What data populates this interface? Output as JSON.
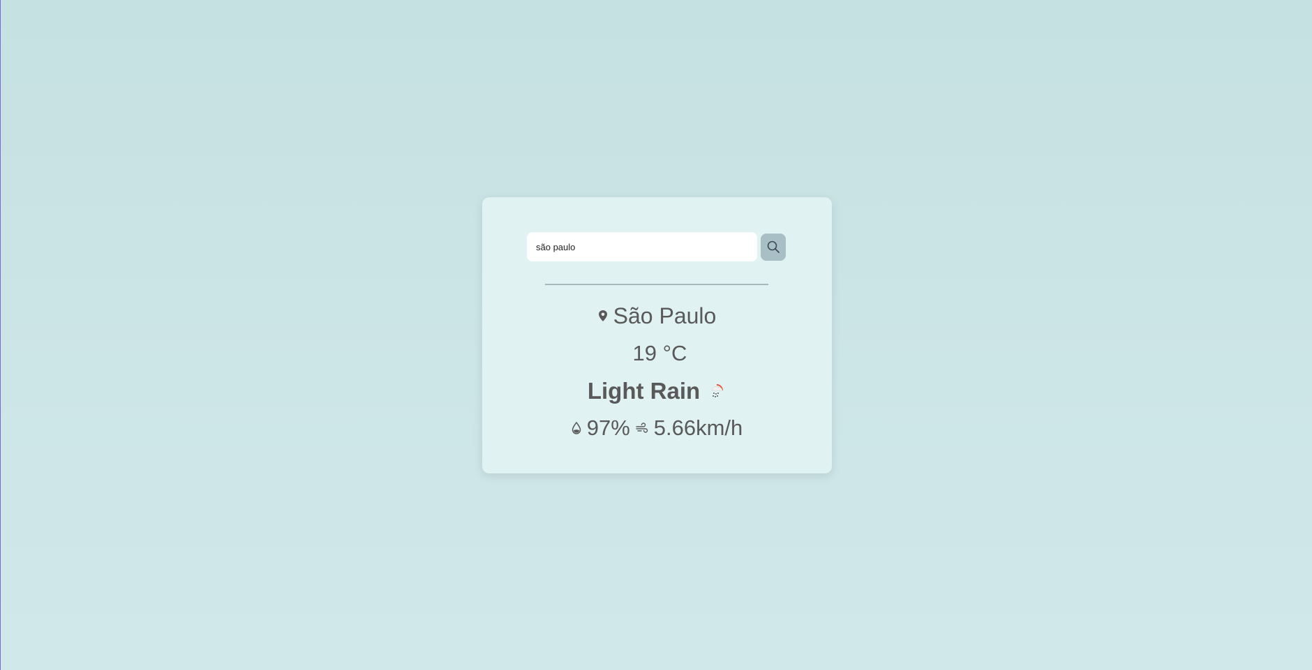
{
  "search": {
    "value": "são paulo",
    "placeholder": ""
  },
  "weather": {
    "city": "São Paulo",
    "temperature": "19 °C",
    "description": "Light Rain",
    "humidity": "97%",
    "wind": "5.66km/h"
  },
  "icons": {
    "search": "search-icon",
    "location": "map-pin-icon",
    "condition": "light-rain-icon",
    "humidity": "water-drop-icon",
    "wind": "wind-icon"
  },
  "colors": {
    "background": "#c6e1e2",
    "card": "#e1f2f2",
    "text": "#595959",
    "search_button": "#a9bfc6",
    "divider": "#a6b8bc",
    "sun_accent": "#e8553c"
  }
}
